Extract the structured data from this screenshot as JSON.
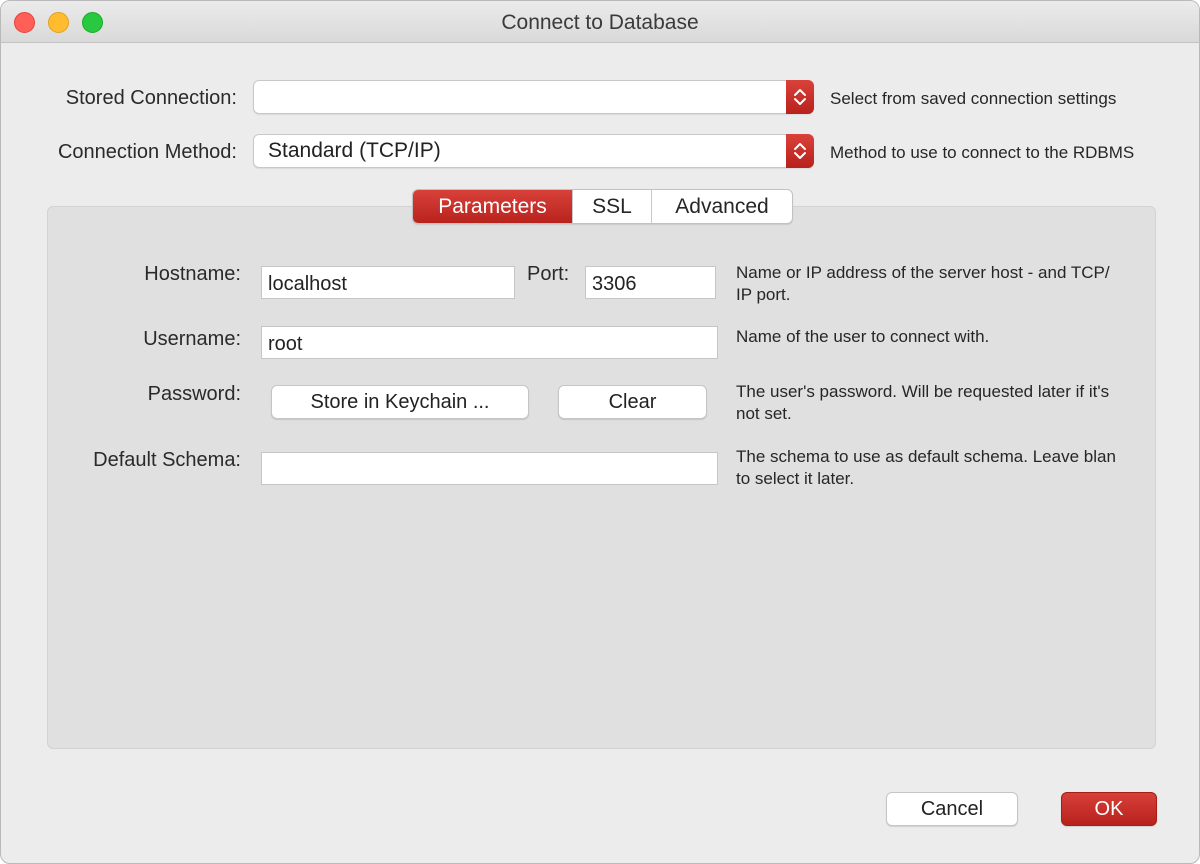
{
  "window": {
    "title": "Connect to Database"
  },
  "stored_connection": {
    "label": "Stored Connection:",
    "value": "",
    "hint": "Select from saved connection settings"
  },
  "connection_method": {
    "label": "Connection Method:",
    "value": "Standard (TCP/IP)",
    "hint": "Method to use to connect to the RDBMS"
  },
  "tabs": [
    {
      "label": "Parameters",
      "active": true
    },
    {
      "label": "SSL",
      "active": false
    },
    {
      "label": "Advanced",
      "active": false
    }
  ],
  "params": {
    "hostname_label": "Hostname:",
    "hostname_value": "localhost",
    "port_label": "Port:",
    "port_value": "3306",
    "hostname_hint_1": "Name or IP address of the server host - and TCP/",
    "hostname_hint_2": "IP port.",
    "username_label": "Username:",
    "username_value": "root",
    "username_hint": "Name of the user to connect with.",
    "password_label": "Password:",
    "store_keychain_label": "Store in Keychain ...",
    "clear_label": "Clear",
    "password_hint_1": "The user's password. Will be requested later if it's",
    "password_hint_2": "not set.",
    "schema_label": "Default Schema:",
    "schema_value": "",
    "schema_hint_1": "The schema to use as default schema. Leave blan",
    "schema_hint_2": "to select it later."
  },
  "footer": {
    "cancel_label": "Cancel",
    "ok_label": "OK"
  },
  "colors": {
    "accent": "#c52b24",
    "window_bg": "#ececec",
    "panel_bg": "#e0e0e0"
  }
}
